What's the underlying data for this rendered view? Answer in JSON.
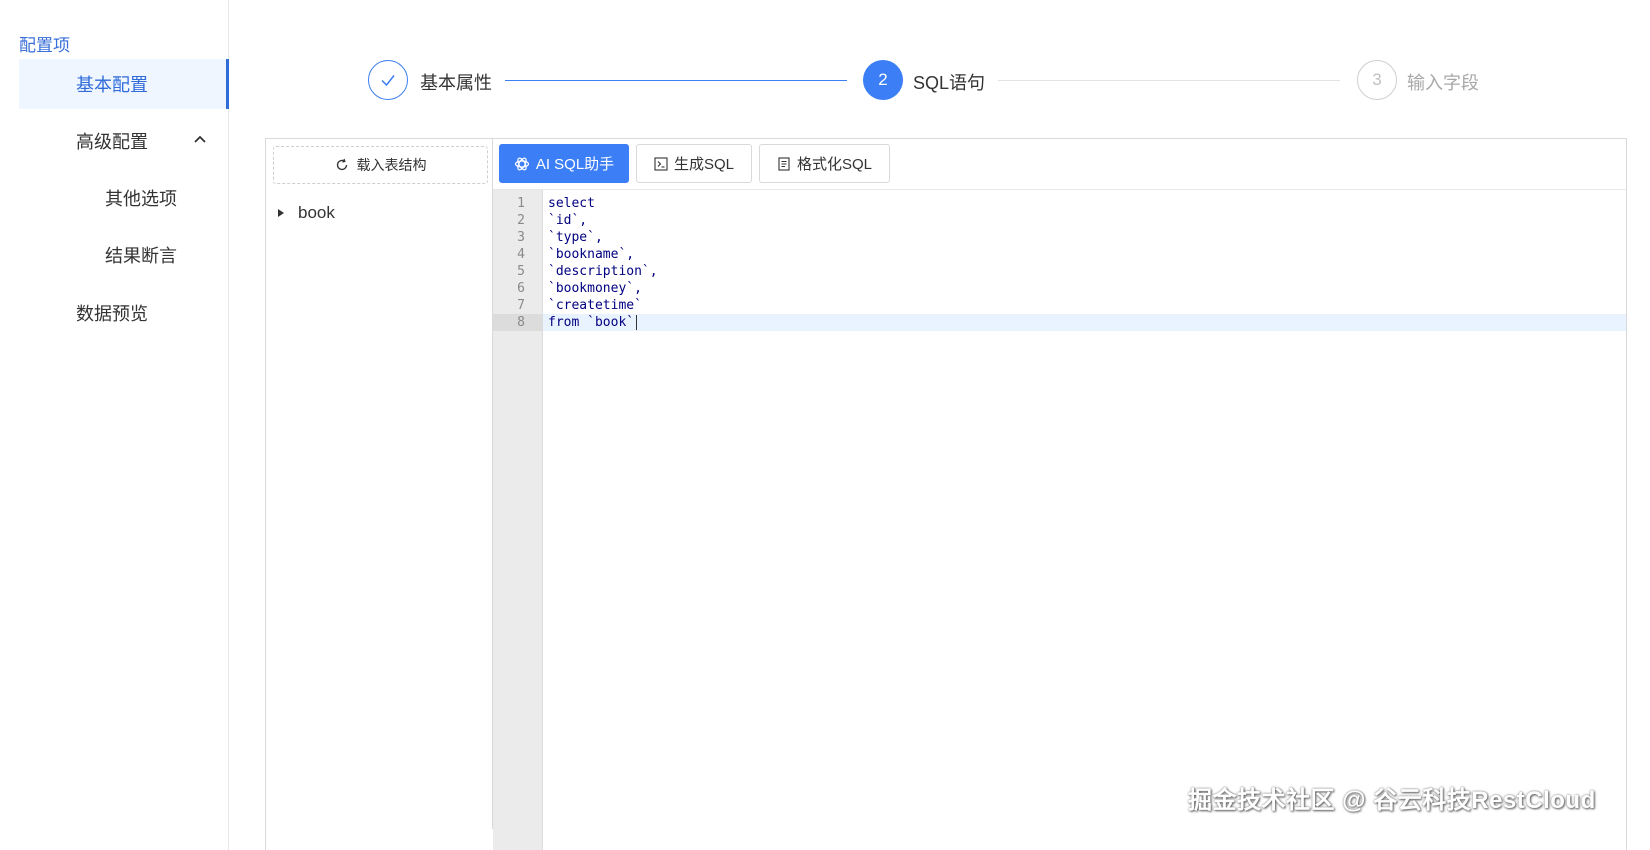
{
  "sidebar": {
    "title": "配置项",
    "items": [
      {
        "label": "基本配置"
      },
      {
        "label": "高级配置"
      },
      {
        "label": "其他选项"
      },
      {
        "label": "结果断言"
      },
      {
        "label": "数据预览"
      }
    ]
  },
  "steps": [
    {
      "number": "",
      "label": "基本属性",
      "status": "finished"
    },
    {
      "number": "2",
      "label": "SQL语句",
      "status": "active"
    },
    {
      "number": "3",
      "label": "输入字段",
      "status": "waiting"
    }
  ],
  "left_pane": {
    "load_button": "载入表结构",
    "tree": [
      {
        "label": "book"
      }
    ]
  },
  "toolbar": {
    "ai_button": "AI SQL助手",
    "generate_button": "生成SQL",
    "format_button": "格式化SQL"
  },
  "editor": {
    "line_numbers": [
      "1",
      "2",
      "3",
      "4",
      "5",
      "6",
      "7",
      "8"
    ],
    "lines": [
      "select",
      "`id`,",
      "`type`,",
      "`bookname`,",
      "`description`,",
      "`bookmoney`,",
      "`createtime`",
      "from `book`"
    ],
    "active_line": 8
  },
  "watermark": "掘金技术社区 @ 谷云科技RestCloud",
  "colors": {
    "accent": "#3b7ef5",
    "active_text": "#2f6bd9",
    "keyword": "#000080"
  }
}
